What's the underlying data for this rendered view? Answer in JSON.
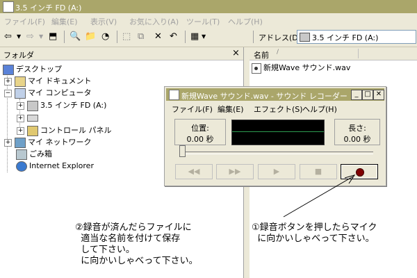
{
  "window": {
    "title": "3.5 インチ FD (A:)"
  },
  "menu": {
    "file": "ファイル(F)",
    "edit": "編集(E)",
    "view": "表示(V)",
    "favorites": "お気に入り(A)",
    "tools": "ツール(T)",
    "help": "ヘルプ(H)"
  },
  "toolbar": {
    "address_label": "アドレス(D)",
    "address_value": "3.5 インチ FD (A:)"
  },
  "folder_pane": {
    "header": "フォルダ",
    "close_glyph": "×",
    "tree": [
      {
        "label": "デスクトップ",
        "expand": ""
      },
      {
        "label": "マイ ドキュメント",
        "expand": "+"
      },
      {
        "label": "マイ コンピュータ",
        "expand": "−"
      },
      {
        "label": "3.5 インチ FD (A:)",
        "expand": "+"
      },
      {
        "label": "",
        "expand": "+"
      },
      {
        "label": "コントロール パネル",
        "expand": "+"
      },
      {
        "label": "マイ ネットワーク",
        "expand": "+"
      },
      {
        "label": "ごみ箱",
        "expand": ""
      },
      {
        "label": "Internet Explorer",
        "expand": ""
      }
    ]
  },
  "file_pane": {
    "column_name": "名前",
    "sort_glyph": "/",
    "files": [
      "新規Wave サウンド.wav"
    ]
  },
  "recorder": {
    "title": "新規Wave サウンド.wav - サウンド レコーダー",
    "menu": {
      "file": "ファイル(F)",
      "edit": "編集(E)",
      "effects": "エフェクト(S)",
      "help": "ヘルプ(H)"
    },
    "position_label": "位置:",
    "position_value": "0.00 秒",
    "length_label": "長さ:",
    "length_value": "0.00 秒",
    "buttons": {
      "rewind": "◀◀",
      "forward": "▶▶",
      "play": "▶",
      "stop": "■"
    },
    "slider_position": 0.0
  },
  "annotations": {
    "left": "②録音が済んだらファイルに\n  適当な名前を付けて保存\n  して下さい。\n  に向かいしゃべって下さい。",
    "right": "①録音ボタンを押したらマイク\n  に向かいしゃべって下さい。"
  }
}
